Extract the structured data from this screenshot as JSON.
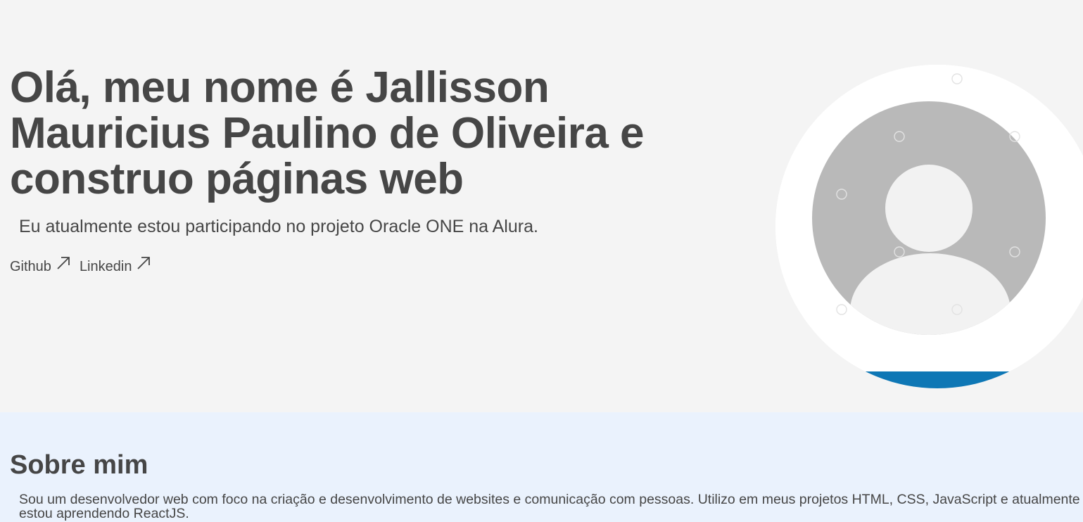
{
  "hero": {
    "title": "Olá, meu nome é Jallisson Mauricius Paulino de Oliveira e construo páginas web",
    "subtitle": "Eu atualmente estou participando no projeto Oracle ONE na Alura.",
    "links": [
      {
        "label": "Github",
        "icon": "arrow-up-right-icon"
      },
      {
        "label": "Linkedin",
        "icon": "arrow-up-right-icon"
      }
    ],
    "avatar": {
      "icon": "user-avatar-icon"
    }
  },
  "about": {
    "title": "Sobre mim",
    "text": "Sou um desenvolvedor web com foco na criação e desenvolvimento de websites e comunicação com pessoas. Utilizo em meus projetos HTML, CSS, JavaScript e atualmente estou aprendendo ReactJS."
  },
  "colors": {
    "hero_background": "#f4f4f4",
    "about_background": "#eaf2fd",
    "text": "#464646",
    "avatar_accent": "#0e77b5"
  }
}
